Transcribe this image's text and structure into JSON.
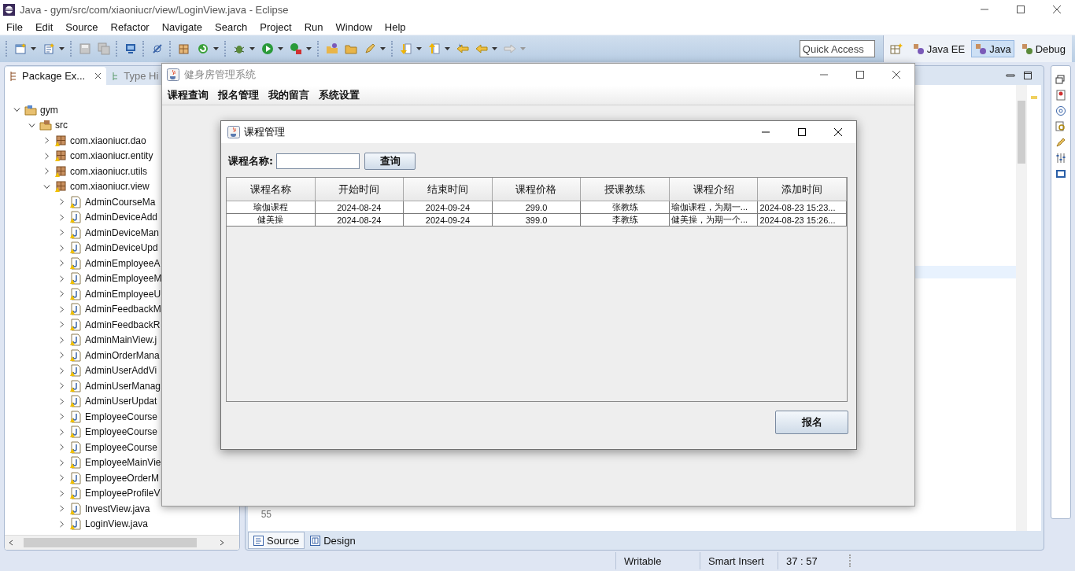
{
  "window": {
    "title": "Java - gym/src/com/xiaoniucr/view/LoginView.java - Eclipse"
  },
  "menu": [
    "File",
    "Edit",
    "Source",
    "Refactor",
    "Navigate",
    "Search",
    "Project",
    "Run",
    "Window",
    "Help"
  ],
  "quick_access": {
    "placeholder": "Quick Access"
  },
  "perspectives": [
    {
      "label": "Java EE",
      "selected": false
    },
    {
      "label": "Java",
      "selected": true
    },
    {
      "label": "Debug",
      "selected": false
    }
  ],
  "left_panel": {
    "tabs": [
      {
        "label": "Package Ex...",
        "selected": true
      },
      {
        "label": "Type Hi",
        "selected": false
      }
    ],
    "tree": [
      {
        "label": "gym",
        "kind": "project",
        "expanded": true,
        "children": [
          {
            "label": "src",
            "kind": "folder",
            "expanded": true,
            "children": [
              {
                "label": "com.xiaoniucr.dao",
                "kind": "package",
                "expanded": false
              },
              {
                "label": "com.xiaoniucr.entity",
                "kind": "package",
                "expanded": false
              },
              {
                "label": "com.xiaoniucr.utils",
                "kind": "package",
                "expanded": false
              },
              {
                "label": "com.xiaoniucr.view",
                "kind": "package",
                "expanded": true,
                "children": [
                  {
                    "label": "AdminCourseMa",
                    "kind": "file",
                    "expanded": false
                  },
                  {
                    "label": "AdminDeviceAdd",
                    "kind": "file",
                    "expanded": false
                  },
                  {
                    "label": "AdminDeviceMan",
                    "kind": "file",
                    "expanded": false
                  },
                  {
                    "label": "AdminDeviceUpd",
                    "kind": "file",
                    "expanded": false
                  },
                  {
                    "label": "AdminEmployeeA",
                    "kind": "file",
                    "expanded": false
                  },
                  {
                    "label": "AdminEmployeeM",
                    "kind": "file",
                    "expanded": false
                  },
                  {
                    "label": "AdminEmployeeU",
                    "kind": "file",
                    "expanded": false
                  },
                  {
                    "label": "AdminFeedbackM",
                    "kind": "file",
                    "expanded": false
                  },
                  {
                    "label": "AdminFeedbackR",
                    "kind": "file",
                    "expanded": false
                  },
                  {
                    "label": "AdminMainView.j",
                    "kind": "file",
                    "expanded": false
                  },
                  {
                    "label": "AdminOrderMana",
                    "kind": "file",
                    "expanded": false
                  },
                  {
                    "label": "AdminUserAddVi",
                    "kind": "file",
                    "expanded": false
                  },
                  {
                    "label": "AdminUserManag",
                    "kind": "file",
                    "expanded": false
                  },
                  {
                    "label": "AdminUserUpdat",
                    "kind": "file",
                    "expanded": false
                  },
                  {
                    "label": "EmployeeCourse",
                    "kind": "file",
                    "expanded": false
                  },
                  {
                    "label": "EmployeeCourse",
                    "kind": "file",
                    "expanded": false
                  },
                  {
                    "label": "EmployeeCourse",
                    "kind": "file",
                    "expanded": false
                  },
                  {
                    "label": "EmployeeMainVie",
                    "kind": "file",
                    "expanded": false
                  },
                  {
                    "label": "EmployeeOrderM",
                    "kind": "file",
                    "expanded": false
                  },
                  {
                    "label": "EmployeeProfileV",
                    "kind": "file",
                    "expanded": false
                  },
                  {
                    "label": "InvestView.java",
                    "kind": "file",
                    "expanded": false
                  },
                  {
                    "label": "LoginView.java",
                    "kind": "file",
                    "expanded": false
                  }
                ]
              }
            ]
          }
        ]
      }
    ]
  },
  "editor": {
    "line_number": "55",
    "tabs": [
      {
        "label": "Source",
        "selected": true
      },
      {
        "label": "Design",
        "selected": false
      }
    ]
  },
  "status_bar": [
    "Writable",
    "Smart Insert",
    "37 : 57"
  ],
  "app_window": {
    "title": "健身房管理系统",
    "menu": [
      "课程查询",
      "报名管理",
      "我的留言",
      "系统设置"
    ],
    "dialog": {
      "title": "课程管理",
      "search_label": "课程名称:",
      "search_button": "查询",
      "table": {
        "columns": [
          "课程名称",
          "开始时间",
          "结束时间",
          "课程价格",
          "授课教练",
          "课程介绍",
          "添加时间"
        ],
        "rows": [
          [
            "瑜伽课程",
            "2024-08-24",
            "2024-09-24",
            "299.0",
            "张教练",
            "瑜伽课程，为期一...",
            "2024-08-23 15:23..."
          ],
          [
            "健美操",
            "2024-08-24",
            "2024-09-24",
            "399.0",
            "李教练",
            "健美操，为期一个...",
            "2024-08-23 15:26..."
          ]
        ]
      },
      "submit_button": "报名"
    }
  }
}
